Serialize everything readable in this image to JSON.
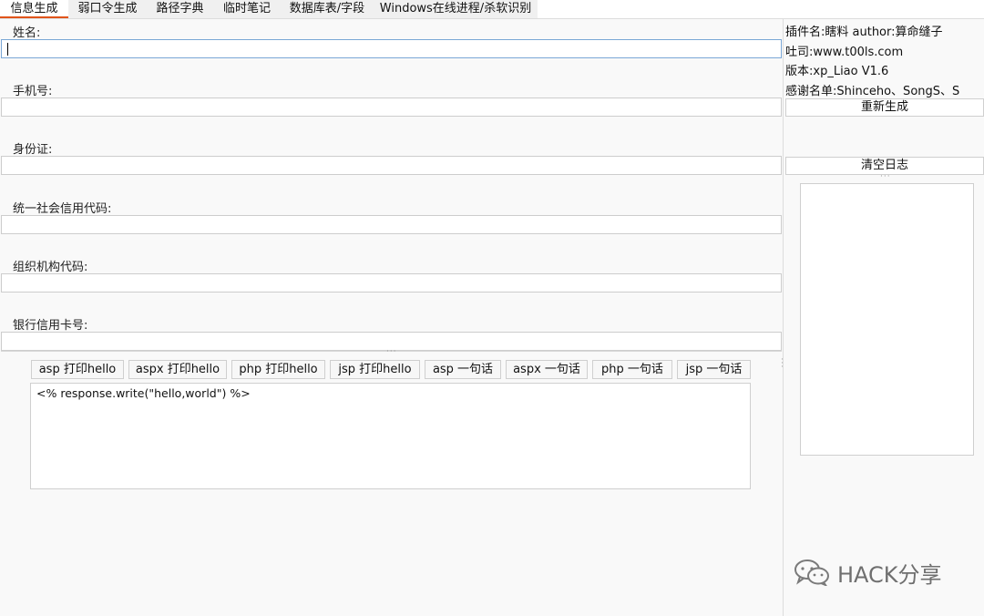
{
  "tabs": [
    {
      "label": "信息生成",
      "active": true
    },
    {
      "label": "弱口令生成",
      "active": false
    },
    {
      "label": "路径字典",
      "active": false
    },
    {
      "label": "临时笔记",
      "active": false
    },
    {
      "label": "数据库表/字段",
      "active": false
    },
    {
      "label": "Windows在线进程/杀软识别",
      "active": false
    }
  ],
  "form": {
    "name_label": "姓名:",
    "phone_label": "手机号:",
    "id_label": "身份证:",
    "credit_code_label": "统一社会信用代码:",
    "org_code_label": "组织机构代码:",
    "bank_card_label": "银行信用卡号:",
    "name_value": "",
    "phone_value": "",
    "id_value": "",
    "credit_code_value": "",
    "org_code_value": "",
    "bank_card_value": ""
  },
  "sidebar": {
    "plugin_line": "插件名:瞎料 author:算命缝子",
    "forum_line": "吐司:www.t00ls.com",
    "version_line": "版本:xp_Liao V1.6",
    "thanks_line": "感谢名单:Shinceho、SongS、S",
    "regenerate_label": "重新生成",
    "clear_log_label": "清空日志"
  },
  "snippets": {
    "buttons": [
      "asp 打印hello",
      "aspx 打印hello",
      "php 打印hello",
      "jsp 打印hello",
      "asp 一句话",
      "aspx 一句话",
      "php 一句话",
      "jsp 一句话"
    ],
    "code_text": "<% response.write(\"hello,world\") %>"
  },
  "watermark": {
    "text": "HACK分享",
    "icon": "wechat-icon"
  },
  "colors": {
    "active_tab_underline": "#e0541a",
    "focus_border": "#7aa7d6",
    "background": "#f9f9f9"
  }
}
